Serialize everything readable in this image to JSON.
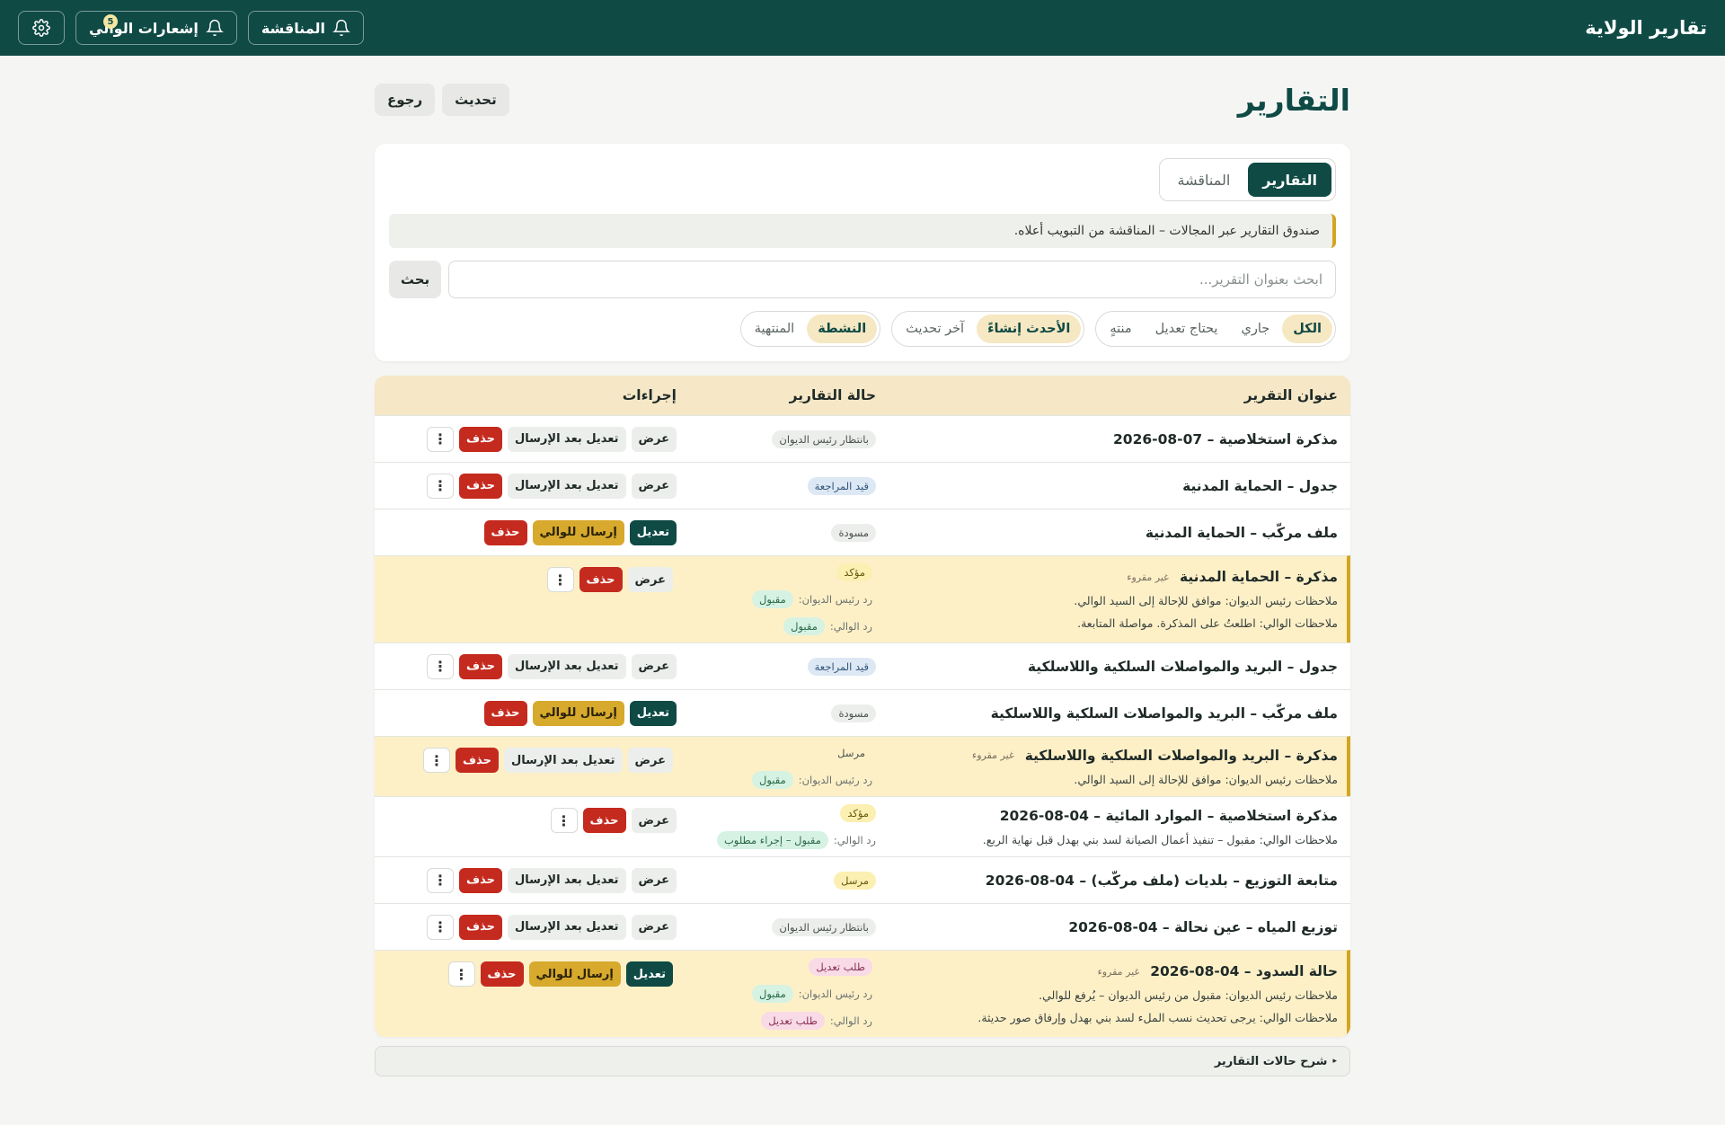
{
  "app": {
    "title": "تقارير الولاية",
    "discussion_btn": "المناقشة",
    "notifications_btn": "إشعارات الوالي",
    "notification_count": "5"
  },
  "page": {
    "title": "التقارير",
    "refresh": "تحديث",
    "back": "رجوع"
  },
  "tabs": [
    {
      "label": "التقارير",
      "active": true
    },
    {
      "label": "المناقشة",
      "active": false
    }
  ],
  "info_text": "صندوق التقارير عبر المجالات – المناقشة من التبويب أعلاه.",
  "search": {
    "placeholder": "ابحث بعنوان التقرير...",
    "button": "بحث"
  },
  "filters": {
    "status": [
      "الكل",
      "جاري",
      "يحتاج تعديل",
      "منتهٍ"
    ],
    "sort": [
      "الأحدث إنشاءً",
      "آخر تحديث"
    ],
    "period": [
      "النشطة",
      "المنتهية"
    ]
  },
  "table": {
    "headers": {
      "title": "عنوان التقرير",
      "status": "حالة التقارير",
      "actions": "إجراءات"
    },
    "actions": {
      "view": "عرض",
      "edit_after": "تعديل بعد الإرسال",
      "delete": "حذف",
      "edit": "تعديل",
      "send": "إرسال للوالي"
    },
    "labels": {
      "unread": "غير مقروء",
      "diwan_reply": "رد رئيس الديوان:",
      "wali_reply": "رد الوالي:"
    },
    "rows": [
      {
        "title": "مذكرة استخلاصية – 07-08-2026",
        "status": "بانتظار رئيس الديوان",
        "status_color": "gray",
        "type": "submitted"
      },
      {
        "title": "جدول – الحماية المدنية",
        "status": "قيد المراجعة",
        "status_color": "blue",
        "type": "submitted"
      },
      {
        "title": "ملف مركّب – الحماية المدنية",
        "status": "مسودة",
        "status_color": "gray",
        "type": "draft"
      },
      {
        "title": "مذكرة – الحماية المدنية",
        "status": "مؤكد",
        "status_color": "yellow",
        "type": "closed",
        "unread": true,
        "notes": [
          "ملاحظات رئيس الديوان: موافق للإحالة إلى السيد الوالي.",
          "ملاحظات الوالي: اطلعتُ على المذكرة. مواصلة المتابعة."
        ],
        "diwan_reply": "مقبول",
        "wali_reply": "مقبول"
      },
      {
        "title": "جدول – البريد والمواصلات السلكية واللاسلكية",
        "status": "قيد المراجعة",
        "status_color": "blue",
        "type": "submitted"
      },
      {
        "title": "ملف مركّب – البريد والمواصلات السلكية واللاسلكية",
        "status": "مسودة",
        "status_color": "gray",
        "type": "draft"
      },
      {
        "title": "مذكرة – البريد والمواصلات السلكية واللاسلكية",
        "status": "مرسل",
        "status_color": "none",
        "type": "submitted",
        "unread": true,
        "notes": [
          "ملاحظات رئيس الديوان: موافق للإحالة إلى السيد الوالي."
        ],
        "diwan_reply": "مقبول"
      },
      {
        "title": "مذكرة استخلاصية – الموارد المائية – 04-08-2026",
        "status": "مؤكد",
        "status_color": "yellow",
        "type": "closed",
        "notes": [
          "ملاحظات الوالي: مقبول – تنفيذ أعمال الصيانة لسد بني بهدل قبل نهاية الربع."
        ],
        "wali_reply": "مقبول – إجراء مطلوب"
      },
      {
        "title": "متابعة التوزيع – بلديات (ملف مركّب) – 04-08-2026",
        "status": "مرسل",
        "status_color": "yellow",
        "type": "submitted"
      },
      {
        "title": "توزيع المياه – عين نحالة – 04-08-2026",
        "status": "بانتظار رئيس الديوان",
        "status_color": "gray",
        "type": "submitted"
      },
      {
        "title": "حالة السدود – 04-08-2026",
        "status": "طلب تعديل",
        "status_color": "pink",
        "type": "revise",
        "unread": true,
        "notes": [
          "ملاحظات رئيس الديوان: مقبول من رئيس الديوان – يُرفع للوالي.",
          "ملاحظات الوالي: يرجى تحديث نسب الملء لسد بني بهدل وإرفاق صور حديثة."
        ],
        "diwan_reply": "مقبول",
        "wali_reply": "طلب تعديل"
      }
    ]
  },
  "legend": "شرح حالات التقارير",
  "colors": {
    "primary": "#0f4a45",
    "accent": "#d4a520",
    "danger": "#c52a1f"
  }
}
